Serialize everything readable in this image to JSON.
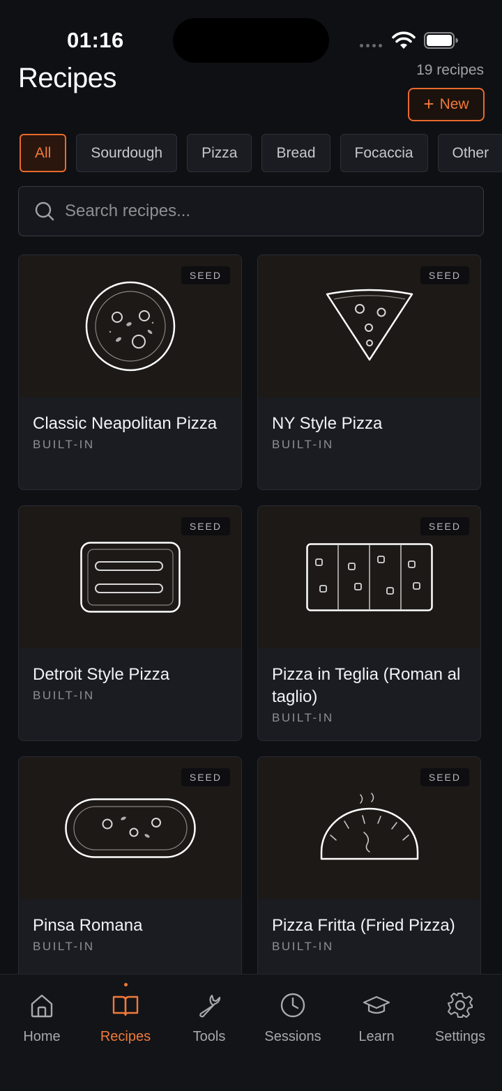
{
  "status_bar": {
    "time": "01:16"
  },
  "header": {
    "title": "Recipes",
    "count": "19 recipes",
    "new_button": "New"
  },
  "filters": [
    "All",
    "Sourdough",
    "Pizza",
    "Bread",
    "Focaccia",
    "Other"
  ],
  "search": {
    "placeholder": "Search recipes..."
  },
  "recipes": [
    {
      "name": "Classic Neapolitan Pizza",
      "badge": "SEED",
      "tag": "BUILT-IN",
      "icon": "round-pizza-icon"
    },
    {
      "name": "NY Style Pizza",
      "badge": "SEED",
      "tag": "BUILT-IN",
      "icon": "pizza-slice-icon"
    },
    {
      "name": "Detroit Style Pizza",
      "badge": "SEED",
      "tag": "BUILT-IN",
      "icon": "pan-pizza-icon"
    },
    {
      "name": "Pizza in Teglia (Roman al taglio)",
      "badge": "SEED",
      "tag": "BUILT-IN",
      "icon": "tray-pizza-icon"
    },
    {
      "name": "Pinsa Romana",
      "badge": "SEED",
      "tag": "BUILT-IN",
      "icon": "oval-pizza-icon"
    },
    {
      "name": "Pizza Fritta (Fried Pizza)",
      "badge": "SEED",
      "tag": "BUILT-IN",
      "icon": "fried-pizza-icon"
    }
  ],
  "tabs": [
    {
      "label": "Home",
      "icon": "home-icon"
    },
    {
      "label": "Recipes",
      "icon": "book-icon",
      "active": true
    },
    {
      "label": "Tools",
      "icon": "wrench-icon"
    },
    {
      "label": "Sessions",
      "icon": "clock-icon"
    },
    {
      "label": "Learn",
      "icon": "graduation-cap-icon"
    },
    {
      "label": "Settings",
      "icon": "gear-icon"
    }
  ],
  "colors": {
    "accent": "#e86a2c",
    "background": "#0f1014",
    "card": "#1b1c22"
  }
}
